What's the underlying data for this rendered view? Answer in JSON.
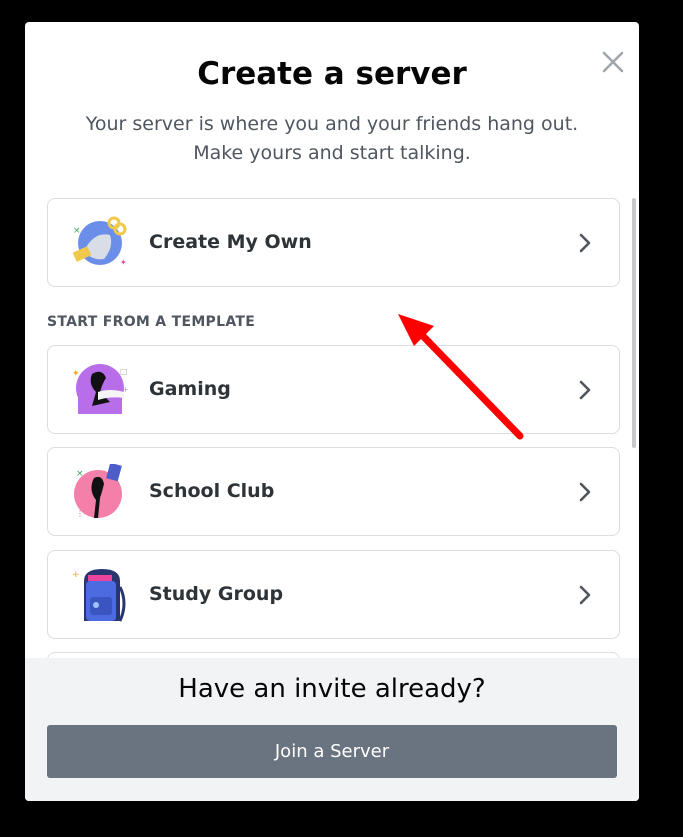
{
  "modal": {
    "title": "Create a server",
    "subtitle": "Your server is where you and your friends hang out. Make yours and start talking."
  },
  "create_own": {
    "label": "Create My Own",
    "icon": "planet-icon"
  },
  "template_section": {
    "heading": "START FROM A TEMPLATE"
  },
  "templates": [
    {
      "label": "Gaming",
      "icon": "gaming-icon"
    },
    {
      "label": "School Club",
      "icon": "school-club-icon"
    },
    {
      "label": "Study Group",
      "icon": "study-group-icon"
    }
  ],
  "footer": {
    "title": "Have an invite already?",
    "join_label": "Join a Server"
  },
  "colors": {
    "join_button": "#6a7480",
    "footer_bg": "#f2f3f5",
    "annotation_arrow": "#ff0000"
  }
}
